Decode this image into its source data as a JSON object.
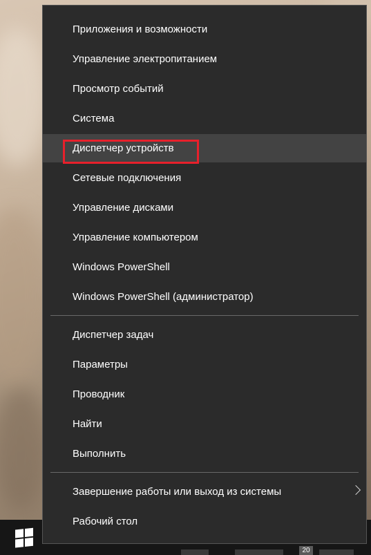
{
  "menu": {
    "group1": [
      {
        "label": "Приложения и возможности"
      },
      {
        "label": "Управление электропитанием"
      },
      {
        "label": "Просмотр событий"
      },
      {
        "label": "Система"
      },
      {
        "label": "Диспетчер устройств",
        "highlighted": true
      },
      {
        "label": "Сетевые подключения"
      },
      {
        "label": "Управление дисками"
      },
      {
        "label": "Управление компьютером"
      },
      {
        "label": "Windows PowerShell"
      },
      {
        "label": "Windows PowerShell (администратор)"
      }
    ],
    "group2": [
      {
        "label": "Диспетчер задач"
      },
      {
        "label": "Параметры"
      },
      {
        "label": "Проводник"
      },
      {
        "label": "Найти"
      },
      {
        "label": "Выполнить"
      }
    ],
    "group3": [
      {
        "label": "Завершение работы или выход из системы",
        "has_submenu": true
      },
      {
        "label": "Рабочий стол"
      }
    ]
  },
  "taskbar": {
    "tray_badge": "20"
  },
  "colors": {
    "menu_background": "#2b2b2b",
    "hover_background": "#434343",
    "highlight_border": "#e8202b",
    "text": "#ffffff"
  },
  "icons": {
    "start": "windows-logo-icon",
    "submenu": "chevron-right-icon"
  }
}
